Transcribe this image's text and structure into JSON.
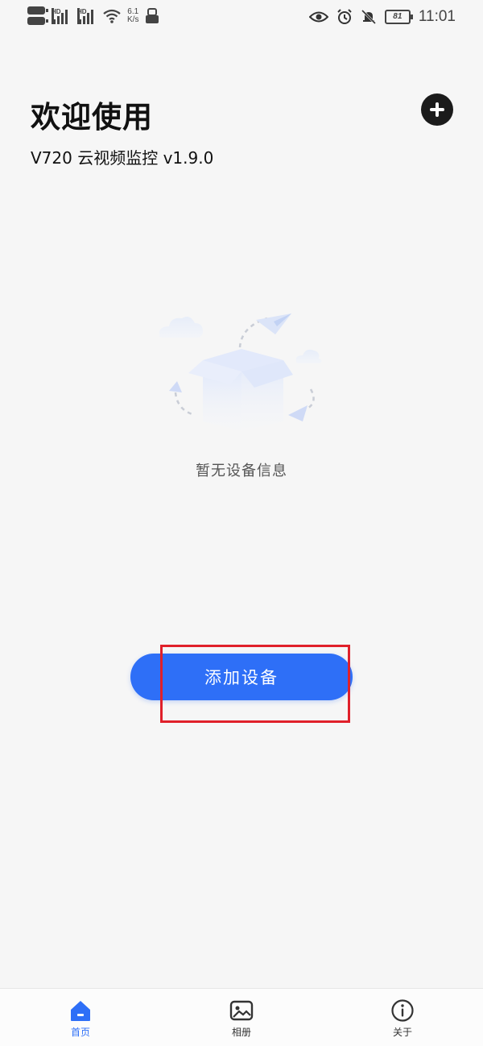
{
  "status_bar": {
    "sim1_tag": "HD",
    "sim2_tag": "HD",
    "net_speed_value": "6.1",
    "net_speed_unit": "K/s",
    "battery": "81",
    "time": "11:01",
    "icons": [
      "sim-icon",
      "signal-icon",
      "wifi-icon",
      "vpn-icon",
      "eye-icon",
      "alarm-icon",
      "mute-bell-icon",
      "battery-icon"
    ]
  },
  "header": {
    "title": "欢迎使用",
    "subtitle": "V720 云视频监控 v1.9.0"
  },
  "empty_state": {
    "text": "暂无设备信息"
  },
  "actions": {
    "add_device_label": "添加设备"
  },
  "bottom_nav": {
    "items": [
      {
        "label": "首页",
        "icon": "home-icon",
        "active": true
      },
      {
        "label": "相册",
        "icon": "image-icon",
        "active": false
      },
      {
        "label": "关于",
        "icon": "info-icon",
        "active": false
      }
    ]
  },
  "colors": {
    "accent": "#2e6ff7",
    "highlight": "#e0202a",
    "background": "#f6f6f6"
  }
}
